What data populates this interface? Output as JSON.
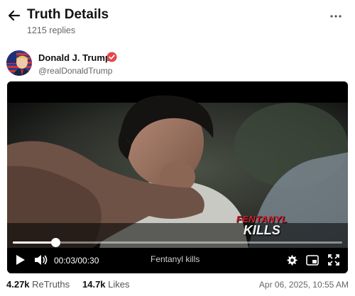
{
  "header": {
    "title": "Truth Details",
    "reply_count": "1215 replies",
    "back_icon": "arrow-left-icon",
    "more_icon": "more-horizontal-icon"
  },
  "author": {
    "name": "Donald J. Trump",
    "handle": "@realDonaldTrump",
    "verified_icon": "verified-badge-icon",
    "verified_color": "#e5484d"
  },
  "video": {
    "overlay_line1": "FENTANYL",
    "overlay_line2": "KILLS",
    "current_time": "00:03",
    "time_separator": "/",
    "duration": "00:30",
    "caption": "Fentanyl kills",
    "progress": 0.13,
    "overlay_color": "#d81e2a"
  },
  "stats": {
    "retruths_count": "4.27k",
    "retruths_label": "ReTruths",
    "likes_count": "14.7k",
    "likes_label": "Likes",
    "timestamp": "Apr 06, 2025, 10:55 AM"
  }
}
